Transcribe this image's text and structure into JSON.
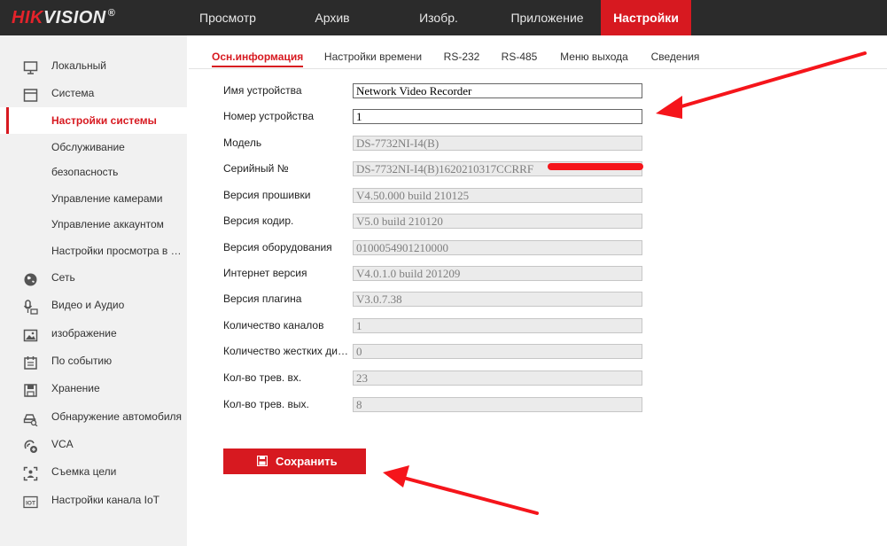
{
  "brand": {
    "part1": "HIK",
    "part2": "VISION",
    "mark": "®"
  },
  "top_nav": [
    "Просмотр",
    "Архив",
    "Изобр.",
    "Приложение",
    "Настройки"
  ],
  "sidebar": {
    "items": [
      {
        "label": "Локальный",
        "icon": "monitor-icon"
      },
      {
        "label": "Система",
        "icon": "system-icon"
      },
      {
        "label": "Настройки системы",
        "active": true
      },
      {
        "label": "Обслуживание"
      },
      {
        "label": "безопасность"
      },
      {
        "label": "Управление камерами"
      },
      {
        "label": "Управление аккаунтом"
      },
      {
        "label": "Настройки просмотра в реальном времени"
      },
      {
        "label": "Сеть",
        "icon": "globe-icon"
      },
      {
        "label": "Видео и Аудио",
        "icon": "microphone-camera-icon"
      },
      {
        "label": "изображение",
        "icon": "image-icon"
      },
      {
        "label": "По событию",
        "icon": "event-calendar-icon"
      },
      {
        "label": "Хранение",
        "icon": "storage-icon"
      },
      {
        "label": "Обнаружение автомобиля",
        "icon": "car-detection-icon"
      },
      {
        "label": "VCA",
        "icon": "vca-icon"
      },
      {
        "label": "Съемка цели",
        "icon": "target-capture-icon"
      },
      {
        "label": "Настройки канала IoT",
        "icon": "iot-icon"
      }
    ]
  },
  "tabs": [
    "Осн.информация",
    "Настройки времени",
    "RS-232",
    "RS-485",
    "Меню выхода",
    "Сведения"
  ],
  "form": {
    "fields": [
      {
        "label": "Имя устройства",
        "value": "Network Video Recorder",
        "editable": true
      },
      {
        "label": "Номер устройства",
        "value": "1",
        "editable": true
      },
      {
        "label": "Модель",
        "value": "DS-7732NI-I4(B)",
        "editable": false
      },
      {
        "label": "Серийный №",
        "value": "DS-7732NI-I4(B)1620210317CCRRF",
        "editable": false
      },
      {
        "label": "Версия прошивки",
        "value": "V4.50.000 build 210125",
        "editable": false
      },
      {
        "label": "Версия кодир.",
        "value": "V5.0 build 210120",
        "editable": false
      },
      {
        "label": "Версия оборудования",
        "value": "0100054901210000",
        "editable": false
      },
      {
        "label": "Интернет версия",
        "value": "V4.0.1.0 build 201209",
        "editable": false
      },
      {
        "label": "Версия плагина",
        "value": "V3.0.7.38",
        "editable": false
      },
      {
        "label": "Количество каналов",
        "value": "1",
        "editable": false
      },
      {
        "label": "Количество жестких дисков",
        "value": "0",
        "editable": false
      },
      {
        "label": "Кол-во трев. вх.",
        "value": "23",
        "editable": false
      },
      {
        "label": "Кол-во трев. вых.",
        "value": "8",
        "editable": false
      }
    ],
    "save_label": "Сохранить"
  },
  "colors": {
    "accent": "#d71920",
    "topbar": "#2b2b2b",
    "sidebar": "#f1f1f1",
    "annotation": "#f5151b"
  }
}
